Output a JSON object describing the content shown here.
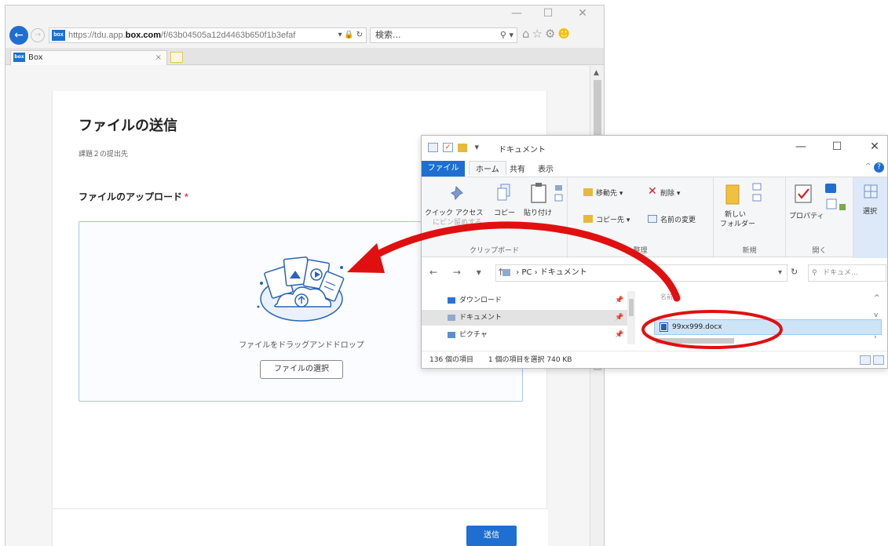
{
  "browser": {
    "url_prefix": "https://tdu.app.",
    "url_host": "box.com",
    "url_path": "/f/63b04505a12d4463b650f1b3efaf",
    "url_icons": "▾ 🔒 ↻",
    "favicon_text": "box",
    "search_placeholder": "検索...",
    "search_icon": "⚲ ▾",
    "tool_icons": "⌂☆⚙",
    "smile_icon": "☻",
    "tab_label": "Box",
    "tab_close": "×",
    "back_glyph": "←",
    "forward_glyph": "→",
    "scroll_up": "▲",
    "minimize": "—",
    "maximize": "☐",
    "close": "✕"
  },
  "form": {
    "title": "ファイルの送信",
    "subtitle": "課題２の提出先",
    "upload_label": "ファイルのアップロード",
    "required_mark": "*",
    "drop_text": "ファイルをドラッグアンドドロップ",
    "select_button": "ファイルの選択",
    "submit_button": "送信"
  },
  "explorer": {
    "title": "ドキュメント",
    "qa_glyph": "✓",
    "qa_dropdown": "▾",
    "file_tab": "ファイル",
    "tabs": [
      "ホーム",
      "共有",
      "表示"
    ],
    "help_caret": "^",
    "help_glyph": "?",
    "minimize": "—",
    "maximize": "☐",
    "close": "✕",
    "ribbon": {
      "clipboard": {
        "quick_access": "クイック アクセス",
        "quick_access_line2": "にピン留めする",
        "copy": "コピー",
        "paste": "貼り付け",
        "group_label": "クリップボード"
      },
      "organize": {
        "move_to": "移動先 ▾",
        "copy_to": "コピー先 ▾",
        "delete": "削除 ▾",
        "rename": "名前の変更",
        "group_label": "整理"
      },
      "new": {
        "new_folder_line1": "新しい",
        "new_folder_line2": "フォルダー",
        "group_label": "新規"
      },
      "open": {
        "properties": "プロパティ",
        "group_label": "開く"
      },
      "select": {
        "select": "選択"
      }
    },
    "nav_arrows": "← → ▾ ↑",
    "path_sep": "›",
    "path": [
      "PC",
      "ドキュメント"
    ],
    "path_dropdown": "▾",
    "refresh_glyph": "↻",
    "search_placeholder": "ドキュメ...",
    "search_icon": "⚲",
    "nav_items": [
      {
        "label": "ダウンロード",
        "pin": "📌"
      },
      {
        "label": "ドキュメント",
        "pin": "📌"
      },
      {
        "label": "ピクチャ",
        "pin": "📌"
      }
    ],
    "scroll_up": "^",
    "scroll_down": "v",
    "scroll_right": "›",
    "column_header": "名前",
    "file_name": "99xx999.docx",
    "status_count": "136 個の項目",
    "status_selected": "1 個の項目を選択  740 KB"
  },
  "colors": {
    "box_blue": "#1e6fd0",
    "annotation_red": "#e01010",
    "dropzone_border": "#a8c4e6"
  }
}
